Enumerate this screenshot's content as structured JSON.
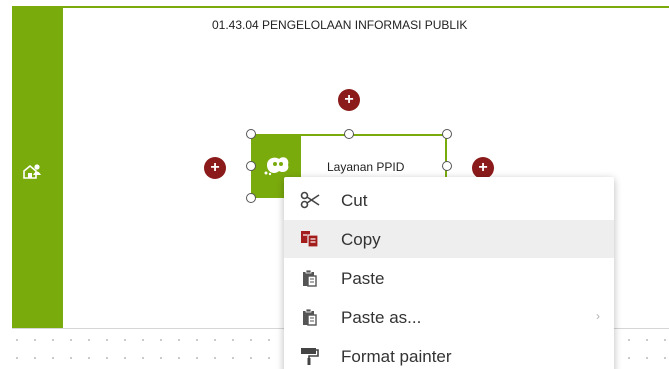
{
  "pool": {
    "title": "01.43.04 PENGELOLAAN INFORMASI PUBLIK",
    "lane_icon": "home-people-icon"
  },
  "task": {
    "label": "Layanan PPID",
    "icon": "user-task-icon"
  },
  "add_buttons": {
    "symbol": "+"
  },
  "context_menu": {
    "items": [
      {
        "label": "Cut",
        "icon": "scissors-icon"
      },
      {
        "label": "Copy",
        "icon": "copy-icon"
      },
      {
        "label": "Paste",
        "icon": "paste-icon"
      },
      {
        "label": "Paste as...",
        "icon": "paste-as-icon",
        "submenu_arrow": "›"
      },
      {
        "label": "Format painter",
        "icon": "format-painter-icon"
      }
    ],
    "hovered_item": "Copy"
  },
  "colors": {
    "accent_green": "#7aab0d",
    "add_button_red": "#8b1a1a",
    "copy_icon_red": "#a31d1d"
  }
}
